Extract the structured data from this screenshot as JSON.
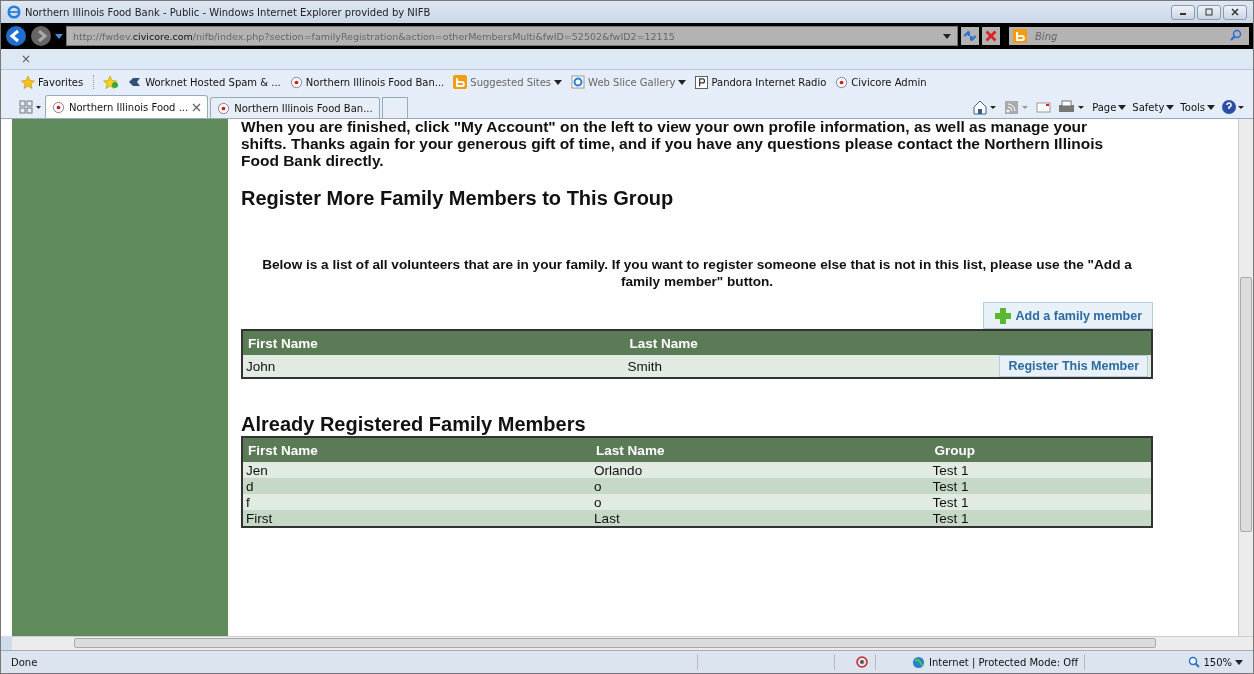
{
  "window": {
    "title": "Northern Illinois Food Bank - Public - Windows Internet Explorer provided by NIFB"
  },
  "address_bar": {
    "url": "http://fwdev.**civicore.com**/nifb/index.php?section=familyRegistration&action=otherMembersMulti&fwID=52502&fwID2=12115"
  },
  "search": {
    "placeholder": "Bing"
  },
  "command_bar": {
    "close": "×"
  },
  "favorites_bar": {
    "favorites": "Favorites",
    "items": [
      {
        "label": "Worknet Hosted Spam & ...",
        "kind": "fish"
      },
      {
        "label": "Northern Illinois Food Ban...",
        "kind": "site"
      },
      {
        "label": "Suggested Sites",
        "kind": "bing"
      },
      {
        "label": "Web Slice Gallery",
        "kind": "ie"
      },
      {
        "label": "Pandora Internet Radio",
        "kind": "p"
      },
      {
        "label": "Civicore Admin",
        "kind": "site"
      }
    ]
  },
  "tabs": [
    {
      "label": "Northern Illinois Food ...",
      "selected": true
    },
    {
      "label": "Northern Illinois Food Ban...",
      "selected": false
    }
  ],
  "toolbar": {
    "menus": [
      "Page",
      "Safety",
      "Tools"
    ]
  },
  "page": {
    "intro": "When you are finished, click \"My Account\" on the left to view your own profile information, as well as manage your shifts. Thanks again for your generous gift of time, and if you have any questions please contact the Northern Illinois Food Bank directly.",
    "heading": "Register More Family Members to This Group",
    "description": "Below is a list of all volunteers that are in your family. If you want to register someone else that is not in this list, please use the \"Add a family member\" button.",
    "add_button": "Add a family member",
    "members": {
      "columns": [
        "First Name",
        "Last Name"
      ],
      "rows": [
        {
          "first": "John",
          "last": "Smith",
          "action": "Register This Member"
        }
      ]
    },
    "registered_heading": "Already Registered Family Members",
    "registered": {
      "columns": [
        "First Name",
        "Last Name",
        "Group"
      ],
      "rows": [
        {
          "first": "Jen",
          "last": "Orlando",
          "group": "Test 1"
        },
        {
          "first": "d",
          "last": "o",
          "group": "Test 1"
        },
        {
          "first": "f",
          "last": "o",
          "group": "Test 1"
        },
        {
          "first": "First",
          "last": "Last",
          "group": "Test 1"
        }
      ]
    }
  },
  "status_bar": {
    "status": "Done",
    "zone": "Internet | Protected Mode: Off",
    "zoom": "150%"
  }
}
